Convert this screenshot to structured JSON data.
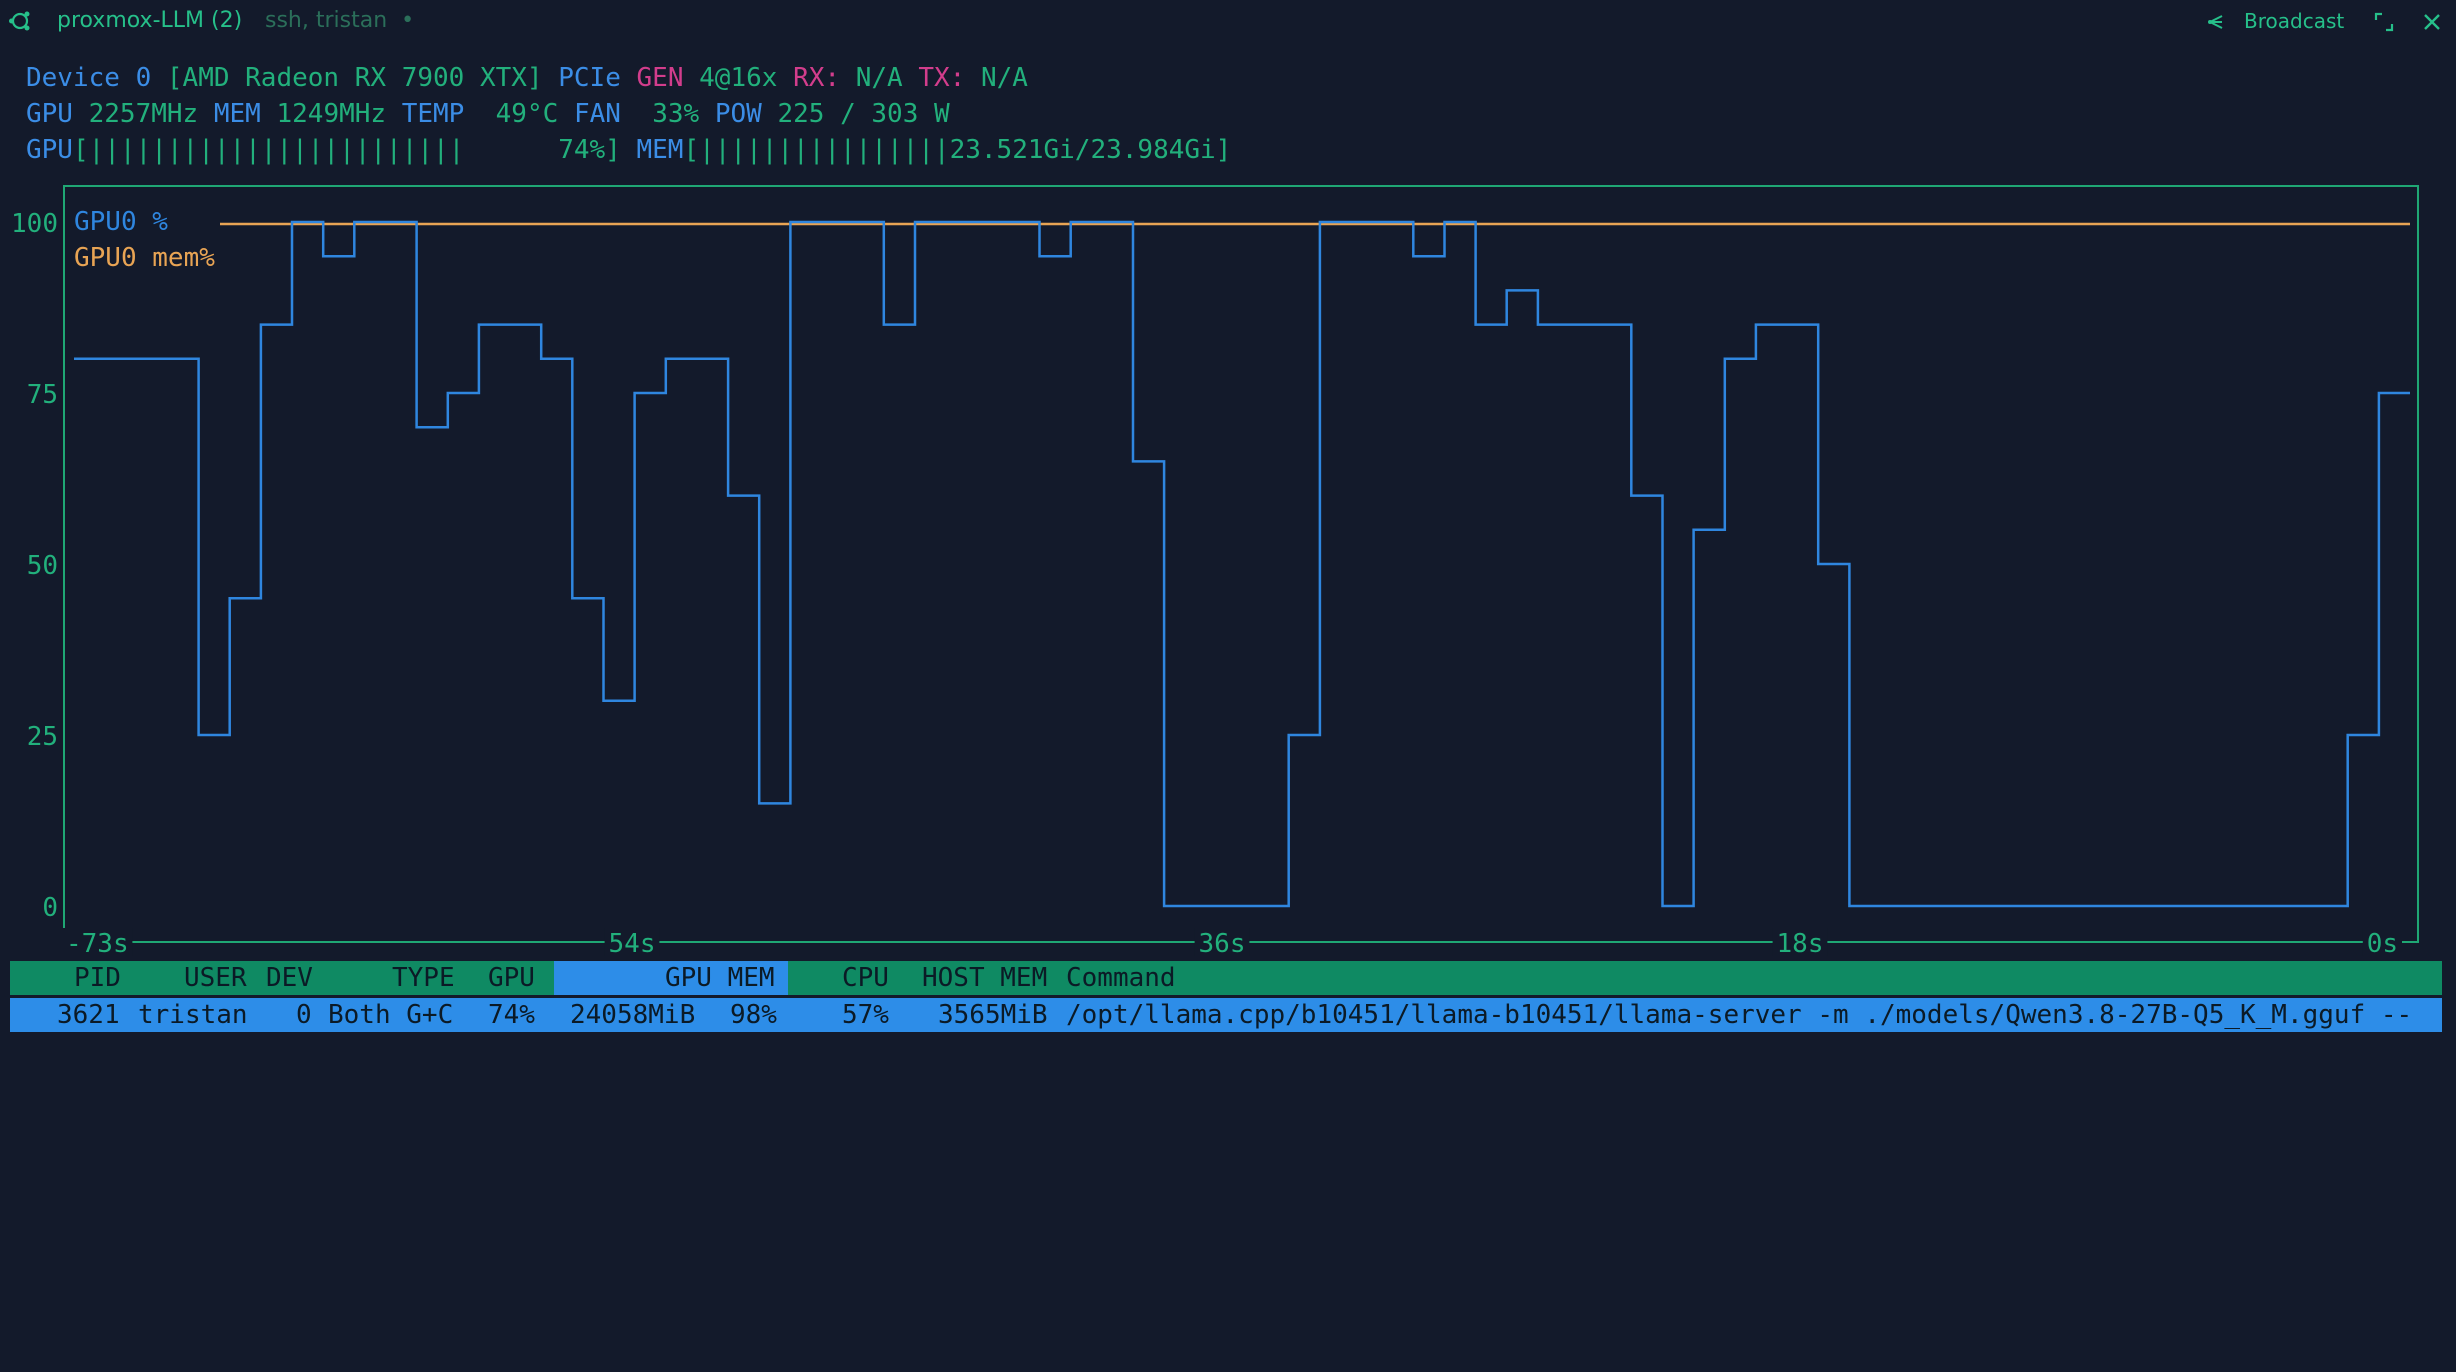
{
  "titlebar": {
    "title": "proxmox-LLM (2)",
    "subtitle": "ssh, tristan  •",
    "broadcast_label": "Broadcast"
  },
  "device_line": {
    "device_label": "Device 0",
    "device_name": "[AMD Radeon RX 7900 XTX]",
    "pcie_label": "PCIe",
    "gen_label": "GEN",
    "gen_value": "4@16x",
    "rx_label": "RX:",
    "rx_value": "N/A",
    "tx_label": "TX:",
    "tx_value": "N/A"
  },
  "stats_line": {
    "gpu_label": "GPU",
    "gpu_clock": "2257MHz",
    "mem_label": "MEM",
    "mem_clock": "1249MHz",
    "temp_label": "TEMP",
    "temp_value": "49°C",
    "fan_label": "FAN",
    "fan_value": "33%",
    "pow_label": "POW",
    "pow_value": "225 / 303 W"
  },
  "bars_line": {
    "gpu_label": "GPU",
    "gpu_bar": "[||||||||||||||||||||||||      74%]",
    "mem_label": "MEM",
    "mem_bar": "[||||||||||||||||23.521Gi/23.984Gi]"
  },
  "chart_data": {
    "type": "line",
    "x_unit": "seconds ago",
    "x_tick_labels": [
      "-73s",
      "54s",
      "36s",
      "18s",
      "0s"
    ],
    "y_tick_labels": [
      "100",
      "75",
      "50",
      "25",
      "0"
    ],
    "ylim": [
      0,
      100
    ],
    "legend": [
      "GPU0 %",
      "GPU0 mem%"
    ],
    "legend_placement": "top-left",
    "series": [
      {
        "name": "GPU0 %",
        "color": "#2f86df",
        "step": true,
        "values": [
          80,
          80,
          80,
          80,
          25,
          45,
          85,
          100,
          95,
          100,
          100,
          70,
          75,
          85,
          85,
          80,
          45,
          30,
          75,
          80,
          80,
          60,
          15,
          100,
          100,
          100,
          85,
          100,
          100,
          100,
          100,
          95,
          100,
          100,
          65,
          0,
          0,
          0,
          0,
          25,
          100,
          100,
          100,
          95,
          100,
          85,
          90,
          85,
          85,
          85,
          60,
          0,
          55,
          80,
          85,
          85,
          50,
          0,
          0,
          0,
          0,
          0,
          0,
          0,
          0,
          0,
          0,
          0,
          0,
          0,
          0,
          0,
          0,
          25,
          75
        ]
      },
      {
        "name": "GPU0 mem%",
        "color": "#e8a454",
        "values": [
          98,
          98
        ]
      }
    ]
  },
  "table": {
    "headers": {
      "pid": "PID",
      "user": "USER",
      "dev": "DEV",
      "type": "TYPE",
      "gpu": "GPU",
      "gpu_mem": "GPU MEM",
      "cpu": "CPU",
      "host_mem": "HOST MEM",
      "command": "Command"
    },
    "rows": [
      {
        "pid": "3621",
        "user": "tristan",
        "dev": "0",
        "type": "Both G+C",
        "gpu": "74%",
        "gpu_mem_mib": "24058MiB",
        "gpu_mem_pct": "98%",
        "cpu": "57%",
        "host_mem": "3565MiB",
        "command": "/opt/llama.cpp/b10451/llama-b10451/llama-server -m ./models/Qwen3.8-27B-Q5_K_M.gguf --"
      }
    ]
  },
  "colors": {
    "background": "#131a2b",
    "frame": "#1fa774",
    "label_blue": "#3b8de6",
    "value_green": "#22b07c",
    "magenta": "#d23d8c",
    "header_bg": "#0f8a63",
    "selected_bg": "#2d8de8"
  }
}
